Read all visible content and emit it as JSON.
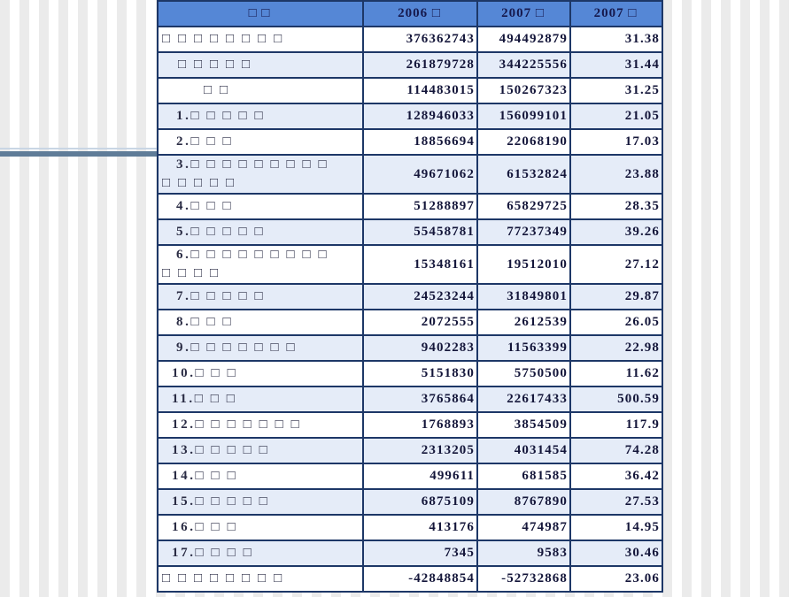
{
  "table": {
    "header": [
      "□ □",
      "2006 □",
      "2007 □",
      "2007 □"
    ],
    "rows": [
      {
        "label": [
          "□ □ □ □ □ □ □ □"
        ],
        "v2006": "376362743",
        "v2007": "494492879",
        "growth": "31.38"
      },
      {
        "label": [
          "□ □ □ □ □"
        ],
        "v2006": "261879728",
        "v2007": "344225556",
        "growth": "31.44"
      },
      {
        "label": [
          "□ □"
        ],
        "v2006": "114483015",
        "v2007": "150267323",
        "growth": "31.25"
      },
      {
        "label": [
          "1.□ □ □ □ □"
        ],
        "v2006": "128946033",
        "v2007": "156099101",
        "growth": "21.05"
      },
      {
        "label": [
          "2.□ □ □"
        ],
        "v2006": "18856694",
        "v2007": "22068190",
        "growth": "17.03"
      },
      {
        "label": [
          "3.□ □ □ □ □ □ □ □ □",
          "□ □ □ □ □"
        ],
        "v2006": "49671062",
        "v2007": "61532824",
        "growth": "23.88"
      },
      {
        "label": [
          "4.□ □ □"
        ],
        "v2006": "51288897",
        "v2007": "65829725",
        "growth": "28.35"
      },
      {
        "label": [
          "5.□ □ □ □ □"
        ],
        "v2006": "55458781",
        "v2007": "77237349",
        "growth": "39.26"
      },
      {
        "label": [
          "6.□ □ □ □ □ □ □ □ □",
          "□ □ □ □"
        ],
        "v2006": "15348161",
        "v2007": "19512010",
        "growth": "27.12"
      },
      {
        "label": [
          "7.□ □ □ □ □"
        ],
        "v2006": "24523244",
        "v2007": "31849801",
        "growth": "29.87"
      },
      {
        "label": [
          "8.□ □ □"
        ],
        "v2006": "2072555",
        "v2007": "2612539",
        "growth": "26.05"
      },
      {
        "label": [
          "9.□ □ □ □ □ □ □"
        ],
        "v2006": "9402283",
        "v2007": "11563399",
        "growth": "22.98"
      },
      {
        "label": [
          "10.□ □ □"
        ],
        "v2006": "5151830",
        "v2007": "5750500",
        "growth": "11.62"
      },
      {
        "label": [
          "11.□ □ □"
        ],
        "v2006": "3765864",
        "v2007": "22617433",
        "growth": "500.59"
      },
      {
        "label": [
          "12.□ □ □ □ □ □ □"
        ],
        "v2006": "1768893",
        "v2007": "3854509",
        "growth": "117.9"
      },
      {
        "label": [
          "13.□ □ □ □ □"
        ],
        "v2006": "2313205",
        "v2007": "4031454",
        "growth": "74.28"
      },
      {
        "label": [
          "14.□ □ □"
        ],
        "v2006": "499611",
        "v2007": "681585",
        "growth": "36.42"
      },
      {
        "label": [
          "15.□ □ □ □ □"
        ],
        "v2006": "6875109",
        "v2007": "8767890",
        "growth": "27.53"
      },
      {
        "label": [
          "16.□ □ □"
        ],
        "v2006": "413176",
        "v2007": "474987",
        "growth": "14.95"
      },
      {
        "label": [
          "17.□ □ □ □"
        ],
        "v2006": "7345",
        "v2007": "9583",
        "growth": "30.46"
      },
      {
        "label": [
          "□ □ □ □ □ □ □ □"
        ],
        "v2006": "-42848854",
        "v2007": "-52732868",
        "growth": "23.06"
      }
    ]
  },
  "colors": {
    "header_bg": "#5587d6",
    "row_alt_bg": "#e5ecf8",
    "border": "#1d3767",
    "accent_line": "#5f7c98"
  }
}
